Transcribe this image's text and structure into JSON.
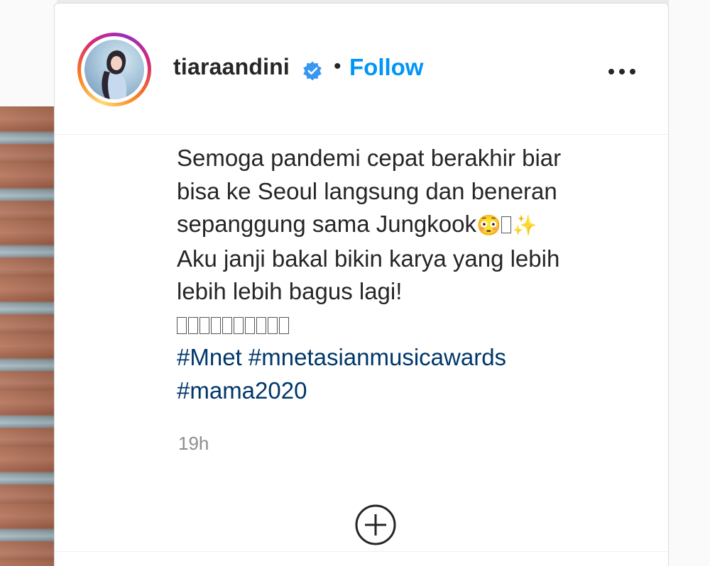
{
  "post": {
    "username": "tiaraandini",
    "separator": "•",
    "follow_label": "Follow",
    "more_icon": "more-horizontal-icon",
    "verified_icon": "verified-badge-icon",
    "colors": {
      "follow": "#0095f6",
      "hashtag": "#00376b",
      "text": "#262626",
      "muted": "#8e8e8e"
    }
  },
  "caption": {
    "line1": "Semoga pandemi cepat berakhir biar",
    "line2": "bisa ke Seoul langsung dan beneran",
    "line3": "sepanggung sama Jungkook",
    "line3_emoji": "😳",
    "line3_emoji2": "✨",
    "line4": "Aku janji bakal bikin karya yang lebih",
    "line5": "lebih lebih bagus lagi!",
    "hashtag1": "#Mnet",
    "hashtag2": "#mnetasianmusicawards",
    "hashtag3": "#mama2020"
  },
  "timestamp": "19h",
  "actions": {
    "add_icon": "add-circle-icon"
  }
}
